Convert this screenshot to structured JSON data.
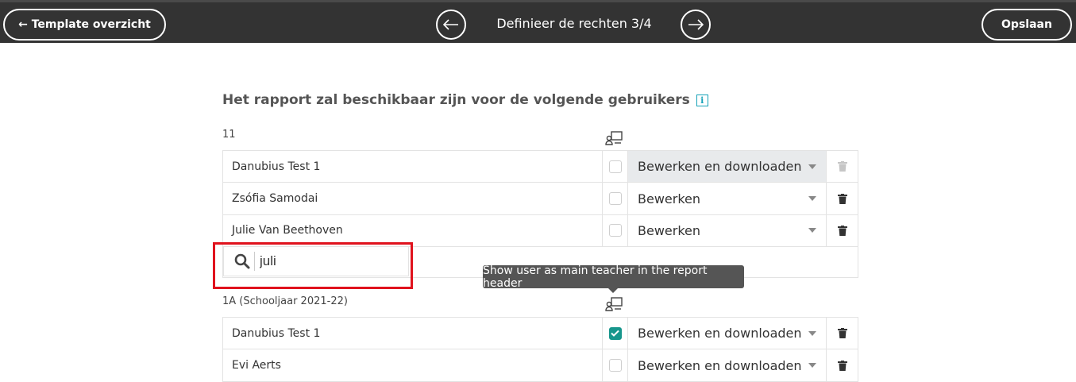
{
  "header": {
    "back_label": "← Template overzicht",
    "step_title": "Definieer de rechten 3/4",
    "save_label": "Opslaan",
    "prev_icon": "arrow-left-icon",
    "next_icon": "arrow-right-icon"
  },
  "main": {
    "heading": "Het rapport zal beschikbaar zijn voor de volgende gebruikers",
    "info_icon": "i"
  },
  "groups": [
    {
      "title": "11",
      "rows": [
        {
          "name": "Danubius Test 1",
          "main_teacher": false,
          "permission": "Bewerken en downloaden",
          "disabled": true
        },
        {
          "name": "Zsófia Samodai",
          "main_teacher": false,
          "permission": "Bewerken",
          "disabled": false
        },
        {
          "name": "Julie Van Beethoven",
          "main_teacher": false,
          "permission": "Bewerken",
          "disabled": false
        }
      ],
      "search": {
        "value": "juli",
        "placeholder": ""
      }
    },
    {
      "title": "1A (Schooljaar 2021-22)",
      "rows": [
        {
          "name": "Danubius Test 1",
          "main_teacher": true,
          "permission": "Bewerken en downloaden",
          "disabled": false
        },
        {
          "name": "Evi Aerts",
          "main_teacher": false,
          "permission": "Bewerken en downloaden",
          "disabled": false
        }
      ]
    }
  ],
  "tooltip": {
    "text": "Show user as main teacher in the report header"
  },
  "colors": {
    "header_bg": "#333333",
    "accent": "#17968c",
    "highlight": "#e0121d"
  }
}
